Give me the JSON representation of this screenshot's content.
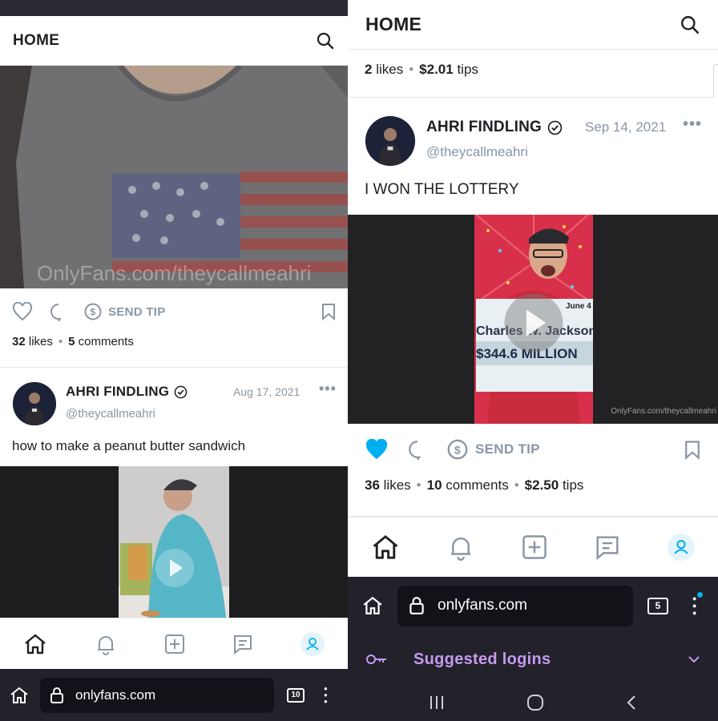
{
  "left": {
    "header": {
      "title": "HOME"
    },
    "post1": {
      "watermark": "OnlyFans.com/theycallmeahri",
      "send_tip": "SEND TIP",
      "likes_count": "32",
      "likes_label": "likes",
      "comments_count": "5",
      "comments_label": "comments"
    },
    "post2": {
      "author": "AHRI FINDLING",
      "handle": "@theycallmeahri",
      "date": "Aug 17, 2021",
      "text": "how to make a peanut butter sandwich"
    },
    "browser": {
      "url": "onlyfans.com",
      "tab_count": "10"
    }
  },
  "right": {
    "header": {
      "title": "HOME"
    },
    "prev_stats": {
      "likes_count": "2",
      "likes_label": "likes",
      "tips_amount": "$2.01",
      "tips_label": "tips"
    },
    "post": {
      "author": "AHRI FINDLING",
      "handle": "@theycallmeahri",
      "date": "Sep 14, 2021",
      "text": "I WON THE LOTTERY",
      "image_date": "June 4",
      "image_name": "Charles W. Jackson",
      "image_amount": "$344.6 MILLION",
      "watermark": "OnlyFans.com/theycallmeahri",
      "send_tip": "SEND TIP",
      "likes_count": "36",
      "likes_label": "likes",
      "comments_count": "10",
      "comments_label": "comments",
      "tips_amount": "$2.50",
      "tips_label": "tips",
      "liked": true
    },
    "browser": {
      "url": "onlyfans.com",
      "tab_count": "5",
      "suggested_logins": "Suggested logins"
    }
  },
  "colors": {
    "accent": "#00aff0",
    "muted": "#8a96a3",
    "logins": "#c39bf0"
  }
}
